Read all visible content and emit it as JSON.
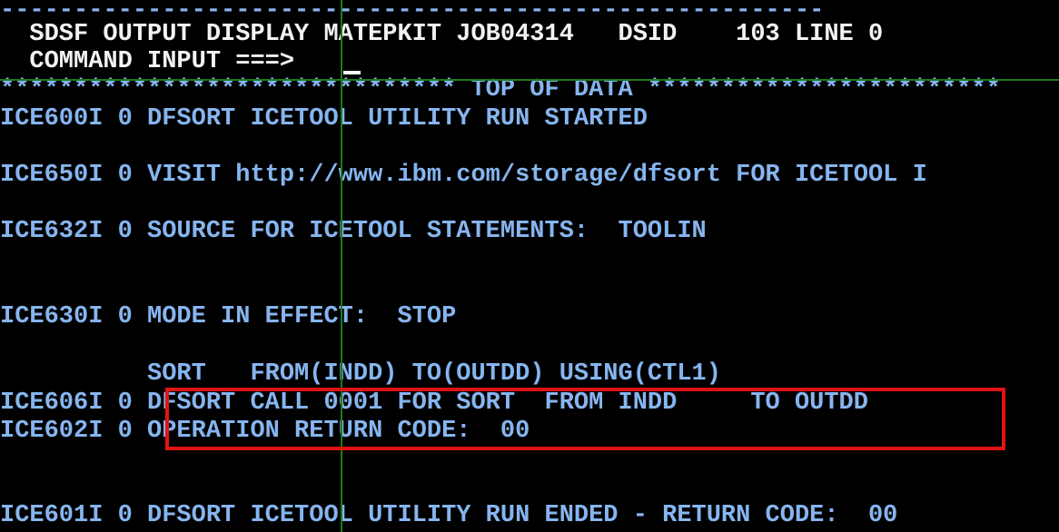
{
  "screen": {
    "background": "#000000",
    "text_color_primary": "#86b5ef",
    "text_color_header": "#f2f2f2",
    "rule_color": "#1e7a1e",
    "annotation_color": "#e11414",
    "columns": 57,
    "rows": 18
  },
  "header": {
    "separator_dashes": "--------------------------------------------------------",
    "title_line": "  SDSF OUTPUT DISPLAY MATEPKIT JOB04314   DSID    103 LINE 0",
    "application": "SDSF OUTPUT DISPLAY",
    "job_name": "MATEPKIT",
    "job_id": "JOB04314",
    "dsid_label": "DSID",
    "dsid_value": "103",
    "line_label": "LINE",
    "line_value": "0",
    "command_line": "  COMMAND INPUT ===>",
    "command_label": "COMMAND INPUT ===>",
    "command_value": ""
  },
  "body": {
    "top_of_data_marker": "******************************* TOP OF DATA ************************",
    "lines": [
      {
        "text": "ICE600I 0 DFSORT ICETOOL UTILITY RUN STARTED"
      },
      {
        "text": ""
      },
      {
        "text": "ICE650I 0 VISIT http://www.ibm.com/storage/dfsort FOR ICETOOL I"
      },
      {
        "text": ""
      },
      {
        "text": "ICE632I 0 SOURCE FOR ICETOOL STATEMENTS:  TOOLIN"
      },
      {
        "text": ""
      },
      {
        "text": ""
      },
      {
        "text": "ICE630I 0 MODE IN EFFECT:  STOP"
      },
      {
        "text": ""
      },
      {
        "text": "          SORT   FROM(INDD) TO(OUTDD) USING(CTL1)"
      },
      {
        "text": "ICE606I 0 DFSORT CALL 0001 FOR SORT  FROM INDD     TO OUTDD"
      },
      {
        "text": "ICE602I 0 OPERATION RETURN CODE:  00"
      },
      {
        "text": ""
      },
      {
        "text": ""
      },
      {
        "text": "ICE601I 0 DFSORT ICETOOL UTILITY RUN ENDED - RETURN CODE:  00"
      }
    ]
  },
  "messages": {
    "ice600i": {
      "id": "ICE600I",
      "severity": "0",
      "text": "DFSORT ICETOOL UTILITY RUN STARTED"
    },
    "ice650i": {
      "id": "ICE650I",
      "severity": "0",
      "text": "VISIT http://www.ibm.com/storage/dfsort FOR ICETOOL I",
      "url": "http://www.ibm.com/storage/dfsort"
    },
    "ice632i": {
      "id": "ICE632I",
      "severity": "0",
      "text": "SOURCE FOR ICETOOL STATEMENTS:  TOOLIN"
    },
    "ice630i": {
      "id": "ICE630I",
      "severity": "0",
      "text": "MODE IN EFFECT:  STOP"
    },
    "sort_stmt": {
      "text": "SORT   FROM(INDD) TO(OUTDD) USING(CTL1)"
    },
    "ice606i": {
      "id": "ICE606I",
      "severity": "0",
      "text": "DFSORT CALL 0001 FOR SORT  FROM INDD     TO OUTDD"
    },
    "ice602i": {
      "id": "ICE602I",
      "severity": "0",
      "text": "OPERATION RETURN CODE:  00",
      "return_code": "00"
    },
    "ice601i": {
      "id": "ICE601I",
      "severity": "0",
      "text": "DFSORT ICETOOL UTILITY RUN ENDED - RETURN CODE:  00",
      "return_code": "00"
    }
  },
  "annotation": {
    "label": "highlighted-return-code-block",
    "color": "#e11414"
  }
}
